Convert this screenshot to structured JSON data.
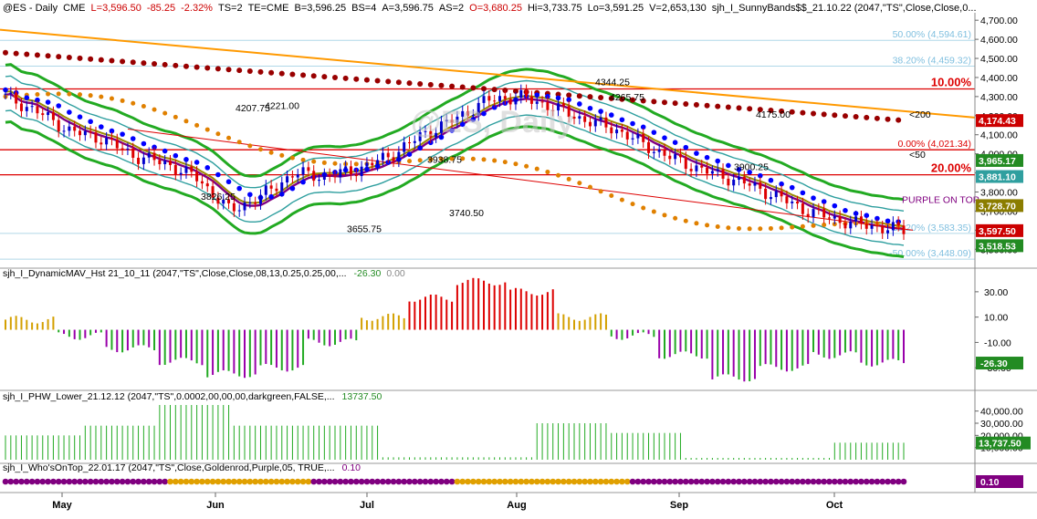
{
  "header": {
    "symbol": "@ES - Daily",
    "exchange": "CME",
    "last": "L=3,596.50",
    "change": "-85.25",
    "pct": "-2.32%",
    "ts": "TS=2",
    "te": "TE=CME",
    "bid": "B=3,596.25",
    "bs": "BS=4",
    "ask": "A=3,596.75",
    "as": "AS=2",
    "open": "O=3,680.25",
    "hi": "Hi=3,733.75",
    "lo": "Lo=3,591.25",
    "vol": "V=2,653,130",
    "study": "sjh_I_SunnyBands$$_21.10.22 (2047,\"TS\",Close,Close,0..."
  },
  "watermark": "@ES, Daily",
  "colors": {
    "up_bar": "#0000cc",
    "down_bar": "#dd0000",
    "positive_hist": "#22aa22",
    "negative_hist": "#9900aa",
    "gold": "#d4a000",
    "green_band": "#22aa22",
    "teal_band": "#2f9f9f",
    "blue_dots": "#0000ff",
    "maroon_dots": "#990000",
    "orange_dots": "#e08000",
    "trend_orange": "#ff9900",
    "red_lines": "#dd0000"
  },
  "chart_data": [
    {
      "type": "line",
      "panel": "price",
      "y_axis_ticks": [
        "4,700.00",
        "4,600.00",
        "4,500.00",
        "4,400.00",
        "4,300.00",
        "4,200.00",
        "4,100.00",
        "4,000.00",
        "3,900.00",
        "3,800.00",
        "3,700.00",
        "3,600.00",
        "3,500.00"
      ],
      "ylim": [
        3420,
        4720
      ],
      "x_axis_labels": [
        "May",
        "Jun",
        "Jul",
        "Aug",
        "Sep",
        "Oct"
      ],
      "series": [
        {
          "name": "Close",
          "x": [
            "May",
            "Jun",
            "Jul",
            "Aug",
            "Sep",
            "Oct"
          ],
          "values": [
            4170,
            4110,
            3830,
            4120,
            3940,
            3597
          ]
        }
      ],
      "fib_levels": [
        {
          "label": "50.00% (4,594.61)",
          "value": 4594.61
        },
        {
          "label": "38.20% (4,459.32)",
          "value": 4459.32
        },
        {
          "label": "10.00%",
          "value": 4340
        },
        {
          "label": "0.00% (4,021.34)",
          "value": 4021.34
        },
        {
          "label": "20.00%",
          "value": 3890
        },
        {
          "label": "-38.20% (3,583.35)",
          "value": 3583.35
        },
        {
          "label": "-50.00% (3,448.09)",
          "value": 3448.09
        }
      ],
      "annotations": [
        {
          "text": "4344.25",
          "value": 4344.25
        },
        {
          "text": "4221.00",
          "value": 4221.0
        },
        {
          "text": "4207.75",
          "value": 4207.75
        },
        {
          "text": "4265.75",
          "value": 4265.75
        },
        {
          "text": "4175.00",
          "value": 4175.0
        },
        {
          "text": "3826.25",
          "value": 3826.25
        },
        {
          "text": "3938.75",
          "value": 3938.75
        },
        {
          "text": "3740.50",
          "value": 3740.5
        },
        {
          "text": "3655.75",
          "value": 3655.75
        },
        {
          "text": "3900.25",
          "value": 3900.25
        },
        {
          "text": "<200",
          "value": 4174.43
        },
        {
          "text": "<50",
          "value": 3965.17
        },
        {
          "text": "PURPLE ON TOP",
          "value": 3728.7
        }
      ],
      "right_labels": [
        {
          "text": "4,174.43",
          "value": 4174.43,
          "color": "#cc0000"
        },
        {
          "text": "3,965.17",
          "value": 3965.17,
          "color": "#228b22"
        },
        {
          "text": "3,881.10",
          "value": 3881.1,
          "color": "#2f9f9f"
        },
        {
          "text": "3,728.70",
          "value": 3728.7,
          "color": "#8b7d00"
        },
        {
          "text": "3,597.50",
          "value": 3597.5,
          "color": "#cc0000"
        },
        {
          "text": "3,518.53",
          "value": 3518.53,
          "color": "#228b22"
        }
      ]
    },
    {
      "type": "bar",
      "panel": "DynamicMAV",
      "title": "sjh_I_DynamicMAV_Hst 21_10_11 (2047,\"TS\",Close,Close,08,13,0.25,0.25,00,...",
      "value_label": "-26.30",
      "zero_label": "0.00",
      "y_axis_ticks": [
        "30.00",
        "10.00",
        "-10.00",
        "-30.00"
      ],
      "ylim": [
        -45,
        40
      ],
      "last_label": "-26.30"
    },
    {
      "type": "bar",
      "panel": "PHW_Lower",
      "title": "sjh_I_PHW_Lower_21.12.12 (2047,\"TS\",0.0002,00,00,00,darkgreen,FALSE,...",
      "value_label": "13737.50",
      "y_axis_ticks": [
        "40,000.00",
        "30,000.00",
        "20,000.00",
        "10,000.00"
      ],
      "ylim": [
        0,
        48000
      ],
      "last_label": "13,737.50"
    },
    {
      "type": "scatter",
      "panel": "WhosOnTop",
      "title": "sjh_I_Who'sOnTop_22.01.17 (2047,\"TS\",Close,Goldenrod,Purple,05, TRUE,...",
      "value_label": "0.10",
      "last_label": "0.10"
    }
  ]
}
